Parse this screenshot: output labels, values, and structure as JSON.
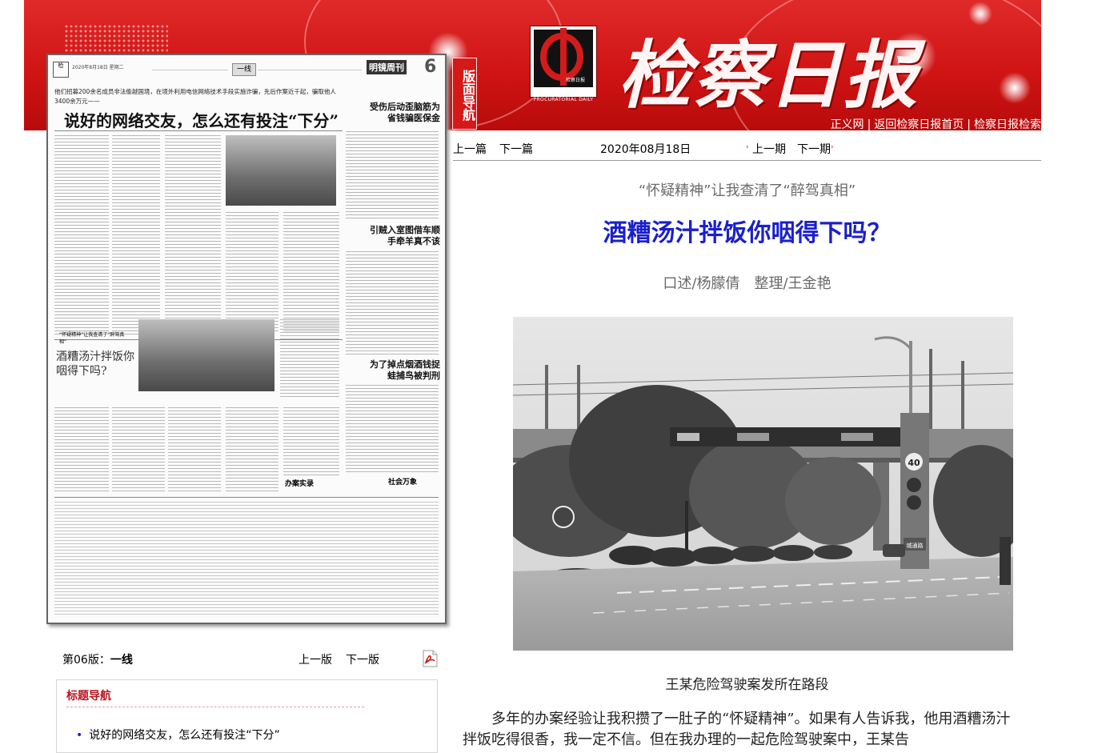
{
  "header": {
    "newspaper_title": "检察日报",
    "logo_caption": "检察日报",
    "logo_english": "PROCURATORIAL DAILY",
    "links": [
      "正义网",
      "返回检察日报首页",
      "检察日报检索"
    ],
    "side_label": "版面导航"
  },
  "thumbnail": {
    "page_date_line": "2020年8月18日 星期二",
    "section": "一线",
    "page_banner": "明镜周刊",
    "page_number": "6",
    "lead_text": "他们招募200余名成员非法偷越国境，在境外利用电信网络技术手段实施诈骗，先后作案近千起，骗取他人3400余万元——",
    "main_headline": "说好的网络交友，怎么还有投注“下分”",
    "side_headline_1": "受伤后动歪脑筋为省钱骗医保金",
    "side_headline_2": "引贼入室图借车顺手牵羊真不该",
    "side_headline_3": "为了掉点烟酒钱捉蛙捕鸟被判刑",
    "feature_kicker": "“怀疑精神”让我查清了“醉驾真相”",
    "feature_headline": "酒糟汤汁拌饭你咽得下吗?",
    "column_tag_1": "办案实录",
    "column_tag_2": "社会万象"
  },
  "article_nav": {
    "prev_article": "上一篇",
    "next_article": "下一篇",
    "date": "2020年08月18日",
    "prev_issue": "上一期",
    "next_issue": "下一期"
  },
  "article": {
    "subtitle": "“怀疑精神”让我查清了“醉驾真相”",
    "headline": "酒糟汤汁拌饭你咽得下吗？",
    "byline": "口述/杨朦倩　整理/王金艳",
    "photo_caption": "王某危险驾驶案发所在路段",
    "photo_sign_text": "40",
    "photo_road_sign": "城通路",
    "body_start": "多年的办案经验让我积攒了一肚子的“怀疑精神”。如果有人告诉我，他用酒糟汤汁拌饭吃得很香，我一定不信。但在我办理的一起危险驾驶案中，王某告"
  },
  "left_panel": {
    "page_label": "第06版：",
    "page_name": "一线",
    "prev_page": "上一版",
    "next_page": "下一版",
    "title_nav_heading": "标题导航",
    "title_nav_items": [
      "说好的网络交友，怎么还有投注“下分”"
    ]
  },
  "colors": {
    "masthead_red": "#d01414",
    "headline_blue": "#1a1fce",
    "nav_heading_red": "#b8141e"
  }
}
